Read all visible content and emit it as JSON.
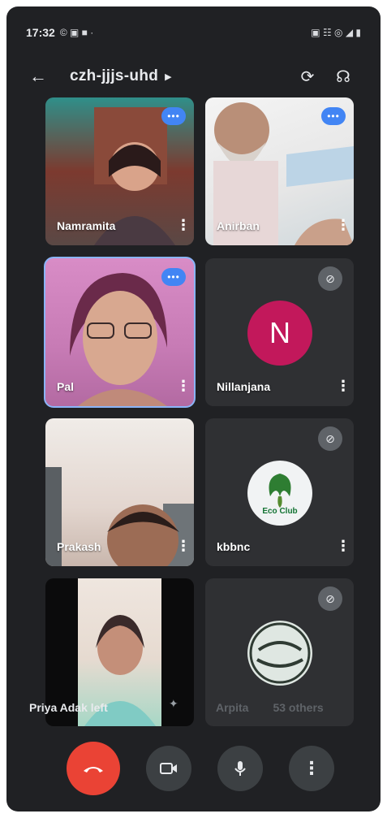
{
  "status_bar": {
    "time": "17:32",
    "left_icons": "© ▣ ■ ·",
    "right_icons": "▣ ☷ ◎ ◢ ▮"
  },
  "header": {
    "meeting_code": "czh-jjjs-uhd"
  },
  "participants": [
    {
      "name": "Namramita",
      "state": "more"
    },
    {
      "name": "Anirban",
      "state": "speaking"
    },
    {
      "name": "Pal",
      "state": "speaking"
    },
    {
      "name": "Nillanjana",
      "state": "muted",
      "avatar_letter": "N",
      "avatar_color": "#c2185b"
    },
    {
      "name": "Prakash",
      "state": "video"
    },
    {
      "name": "kbbnc",
      "state": "muted",
      "logo_text": "Eco Club"
    },
    {
      "name": "",
      "state": "video"
    },
    {
      "name": "",
      "state": "muted"
    }
  ],
  "notice": {
    "text": "Priya Adak left"
  },
  "overflow": {
    "name": "Arpita",
    "others": "53 others"
  },
  "colors": {
    "background": "#202124",
    "end_call": "#ea4335",
    "speaking": "#4285f4",
    "active_border": "#8ab4f8"
  }
}
